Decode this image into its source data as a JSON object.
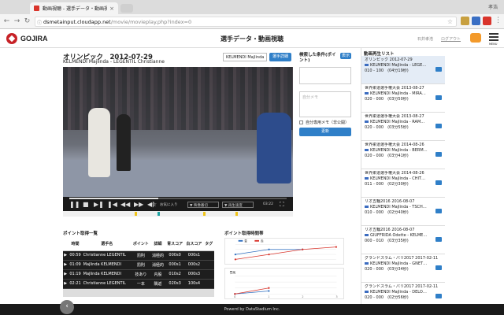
{
  "browser": {
    "tab_title": "動画視聴 - 選手データ・動画視聴",
    "tab_close": "×",
    "profile": "孝浩",
    "url_host": "dsmetainput.cloudapp.net",
    "url_path": "/movie/movieplay.php?index=0"
  },
  "header": {
    "logo": "GOJIRA",
    "title": "選手データ・動画視聴",
    "user": "石井孝浩",
    "logout": "ログアウト",
    "menu_label": "MENU"
  },
  "video": {
    "title": "オリンピック　2012-07-29",
    "subtitle": "KELMENDI Majlinda - LEGENTIL Christianne",
    "player_select": "KELMENDI Majlinda",
    "detail_button": "選手詳細",
    "time": "03:22",
    "progress": 0.41,
    "favorite": "お気に入り",
    "scene_select": "映像番切",
    "speed_select": "再生速度",
    "timeline_marks": [
      {
        "pos": 0.31,
        "color": "#f0c419"
      },
      {
        "pos": 0.41,
        "color": "#1fa3a3"
      },
      {
        "pos": 0.61,
        "color": "#f0c419"
      },
      {
        "pos": 0.75,
        "color": "#f0c419"
      }
    ]
  },
  "search_panel": {
    "label": "検索した条件(ポイント)",
    "show_button": "表示",
    "memo_placeholder": "自分メモ",
    "checkbox_label": "自分専用メモ（非公開）",
    "update_button": "更新"
  },
  "point_table": {
    "title": "ポイント取得一覧",
    "headers": [
      "",
      "時間",
      "選手名",
      "ポイント",
      "詳細",
      "青スコア",
      "白スコア",
      "タグ"
    ],
    "rows": [
      [
        "▶",
        "00:59",
        "Christianne LEGENTIL",
        "罰則",
        "消極的",
        "000s0",
        "000s1",
        ""
      ],
      [
        "▶",
        "01:09",
        "Majlinda KELMENDI",
        "罰則",
        "消極的",
        "000s1",
        "000s2",
        ""
      ],
      [
        "▶",
        "01:19",
        "Majlinda KELMENDI",
        "技あり",
        "内股",
        "010s2",
        "000s3",
        ""
      ],
      [
        "▶",
        "02:21",
        "Christianne LEGENTIL",
        "一本",
        "隅返",
        "020s3",
        "100s4",
        ""
      ]
    ]
  },
  "charts": {
    "title": "ポイント取得時間帯",
    "chart_data": [
      {
        "type": "line",
        "x": [
          0,
          1,
          2,
          3
        ],
        "series": [
          {
            "name": "青",
            "color": "#2f6fc0",
            "values": [
              1,
              2,
              2,
              null
            ]
          },
          {
            "name": "赤",
            "color": "#d9342b",
            "values": [
              0,
              1,
              2,
              2.5
            ]
          }
        ],
        "ylim": [
          0,
          3
        ]
      },
      {
        "type": "line",
        "x": [
          0,
          1,
          2,
          3
        ],
        "label": "罰則",
        "series": [
          {
            "name": "",
            "color": "#2f6fc0",
            "values": [
              0,
              0.5,
              null,
              null
            ]
          },
          {
            "name": "",
            "color": "#d9342b",
            "values": [
              0,
              1,
              null,
              null
            ]
          }
        ],
        "xticks": [
          "0",
          "1",
          "2",
          "3"
        ],
        "ylim": [
          0,
          3
        ]
      }
    ]
  },
  "right_list": {
    "title": "動画再生リスト",
    "items": [
      {
        "l1": "オリンピック 2012-07-29",
        "l2": "KELMENDI Majlinda - LEGE…",
        "l3": "010 - 100　(04分19秒)"
      },
      {
        "l1": "世界柔道選手権大会 2013-08-27",
        "l2": "KELMENDI Majlinda - MIRA…",
        "l3": "020 - 000　(03分50秒)"
      },
      {
        "l1": "世界柔道選手権大会 2013-08-27",
        "l2": "KELMENDI Majlinda - RAM…",
        "l3": "020 - 000　(03分55秒)"
      },
      {
        "l1": "世界柔道選手権大会 2014-08-26",
        "l2": "KELMENDI Majlinda - BERM…",
        "l3": "020 - 000　(03分41秒)"
      },
      {
        "l1": "世界柔道選手権大会 2014-08-26",
        "l2": "KELMENDI Majlinda - CHIT…",
        "l3": "011 - 000　(02分30秒)"
      },
      {
        "l1": "リオ五輪2016 2016-08-07",
        "l2": "KELMENDI Majlinda - TSCH…",
        "l3": "010 - 000　(02分40秒)"
      },
      {
        "l1": "リオ五輪2016 2016-08-07",
        "l2": "GIUFFRIDA Odette - KELME…",
        "l3": "000 - 010　(03分35秒)"
      },
      {
        "l1": "グランドスラム・パリ2017 2017-02-11",
        "l2": "KELMENDI Majlinda - GNET…",
        "l3": "020 - 000　(03分34秒)"
      },
      {
        "l1": "グランドスラム・パリ2017 2017-02-11",
        "l2": "KELMENDI Majlinda - DELO…",
        "l3": "020 - 000　(02分56秒)"
      }
    ]
  },
  "footer": {
    "text": "Powerd by DataStadium Inc.",
    "back": "‹"
  }
}
